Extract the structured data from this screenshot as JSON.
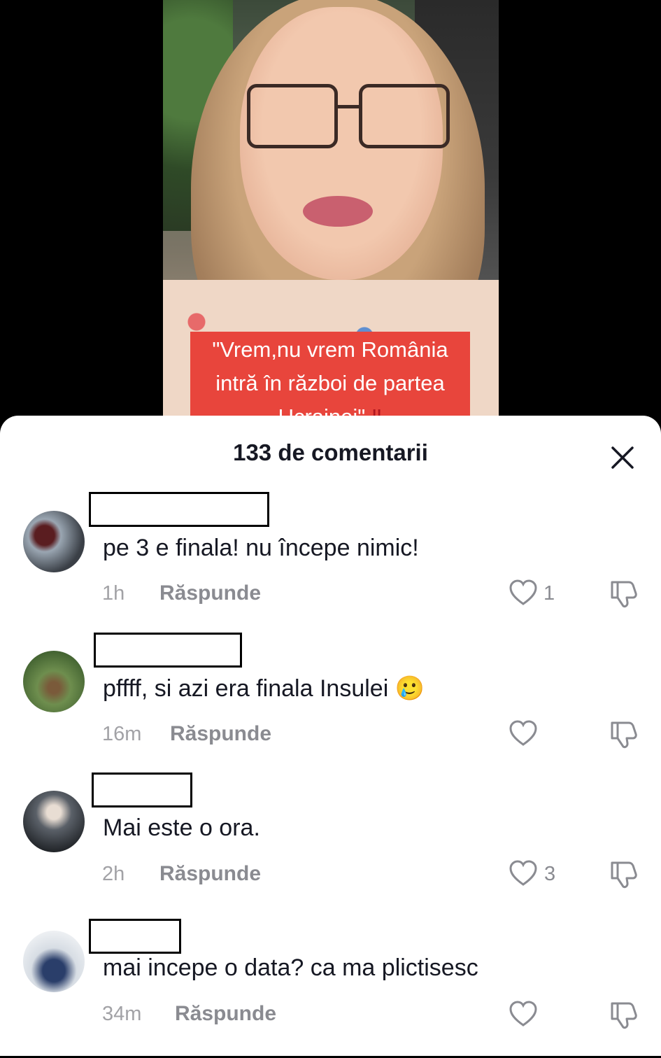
{
  "video": {
    "caption_lines": [
      "\"Vrem,nu vrem România",
      "intră în război de partea",
      "Ucrainei\""
    ],
    "caption_emoji": "‼"
  },
  "comments_panel": {
    "title": "133 de comentarii",
    "close_icon": "close-icon",
    "comments": [
      {
        "text": "pe 3 e finala! nu începe nimic!",
        "time": "1h",
        "reply_label": "Răspunde",
        "likes": "1"
      },
      {
        "text": "pffff, si azi era finala Insulei",
        "emoji": "🥲",
        "time": "16m",
        "reply_label": "Răspunde",
        "likes": ""
      },
      {
        "text": "Mai este o ora.",
        "time": "2h",
        "reply_label": "Răspunde",
        "likes": "3"
      },
      {
        "text": "mai incepe o data? ca ma plictisesc",
        "time": "34m",
        "reply_label": "Răspunde",
        "likes": ""
      }
    ]
  },
  "colors": {
    "caption_bg": "#e8453c",
    "text_primary": "#161823",
    "text_secondary": "#8a8b91"
  }
}
